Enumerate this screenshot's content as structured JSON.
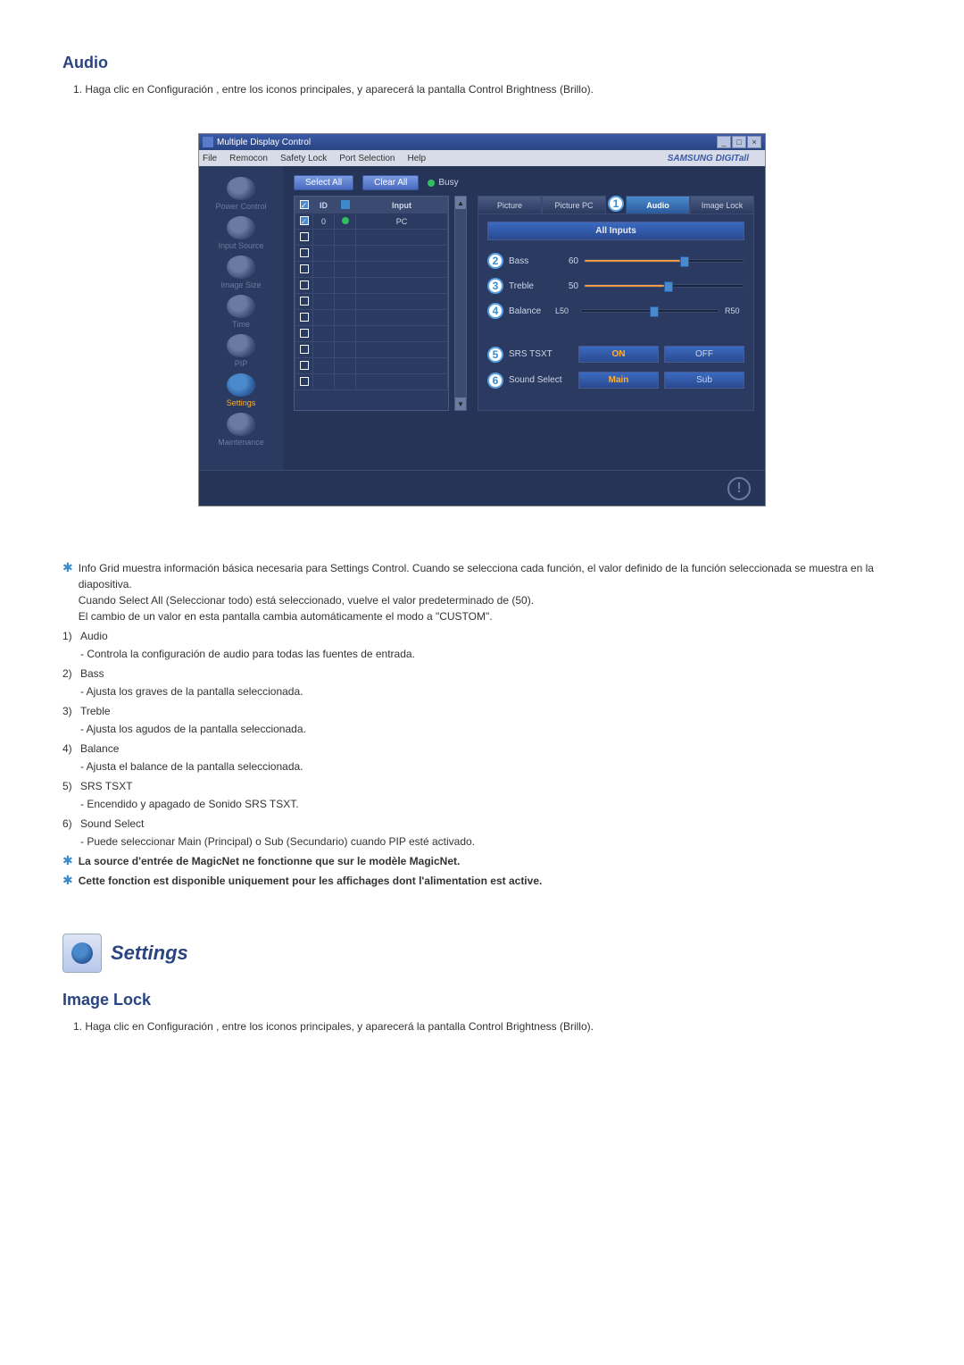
{
  "section1": {
    "title": "Audio",
    "step": "1.  Haga clic en Configuración , entre los iconos principales, y aparecerá la pantalla Control Brightness (Brillo)."
  },
  "app": {
    "title": "Multiple Display Control",
    "menu": [
      "File",
      "Remocon",
      "Safety Lock",
      "Port Selection",
      "Help"
    ],
    "brand": "SAMSUNG DIGITall",
    "sidebar": [
      {
        "label": "Power Control"
      },
      {
        "label": "Input Source"
      },
      {
        "label": "Image Size"
      },
      {
        "label": "Time"
      },
      {
        "label": "PIP"
      },
      {
        "label": "Settings",
        "active": true
      },
      {
        "label": "Maintenance"
      }
    ],
    "selectAll": "Select All",
    "clearAll": "Clear All",
    "busy": "Busy",
    "cols": {
      "chk": "",
      "id": "ID",
      "st": "",
      "input": "Input"
    },
    "row": {
      "id": "0",
      "input": "PC"
    },
    "tabs": [
      {
        "l": "Picture"
      },
      {
        "l": "Picture PC"
      },
      {
        "l": "Audio",
        "a": true
      },
      {
        "l": "Image Lock"
      }
    ],
    "allInputs": "All Inputs",
    "sliders": [
      {
        "n": "2",
        "label": "Bass",
        "val": "60",
        "pct": 60
      },
      {
        "n": "3",
        "label": "Treble",
        "val": "50",
        "pct": 50
      }
    ],
    "balance": {
      "n": "4",
      "label": "Balance",
      "l": "L50",
      "r": "R50",
      "pct": 50
    },
    "srs": {
      "n": "5",
      "label": "SRS TSXT",
      "on": "ON",
      "off": "OFF"
    },
    "sound": {
      "n": "6",
      "label": "Sound Select",
      "main": "Main",
      "sub": "Sub"
    },
    "callout1": "1"
  },
  "notes": {
    "star1a": "Info Grid muestra información básica necesaria para Settings Control. Cuando se selecciona cada función, el valor definido de la función seleccionada se muestra en la diapositiva.",
    "star1b": "Cuando Select All (Seleccionar todo) está seleccionado, vuelve el valor predeterminado de (50).",
    "star1c": "El cambio de un valor en esta pantalla cambia automáticamente el modo a \"CUSTOM\".",
    "items": [
      {
        "n": "1)",
        "t": "Audio",
        "d": "- Controla la configuración de audio para todas las fuentes de entrada."
      },
      {
        "n": "2)",
        "t": "Bass",
        "d": "- Ajusta los graves de la pantalla seleccionada."
      },
      {
        "n": "3)",
        "t": "Treble",
        "d": "- Ajusta los agudos de la pantalla seleccionada."
      },
      {
        "n": "4)",
        "t": "Balance",
        "d": "- Ajusta el balance de la pantalla seleccionada."
      },
      {
        "n": "5)",
        "t": "SRS TSXT",
        "d": "- Encendido y apagado de Sonido SRS TSXT."
      },
      {
        "n": "6)",
        "t": "Sound Select",
        "d": "- Puede seleccionar Main (Principal) o Sub (Secundario) cuando PIP esté activado."
      }
    ],
    "star2": "La source d'entrée de MagicNet ne fonctionne que sur le modèle MagicNet.",
    "star3": "Cette fonction est disponible uniquement pour les affichages dont l'alimentation est active."
  },
  "settingsHdr": "Settings",
  "section2": {
    "title": "Image Lock",
    "step": "1.  Haga clic en Configuración , entre los iconos principales, y aparecerá la pantalla Control Brightness (Brillo)."
  }
}
